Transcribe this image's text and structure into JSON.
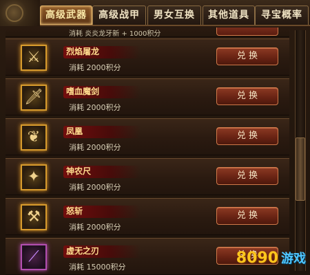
{
  "tabs": [
    {
      "label": "高级武器",
      "active": true
    },
    {
      "label": "高级战甲",
      "active": false
    },
    {
      "label": "男女互换",
      "active": false
    },
    {
      "label": "其他道具",
      "active": false
    },
    {
      "label": "寻宝概率",
      "active": false
    }
  ],
  "partial_row": {
    "cost_text": "消耗 炎炎龙牙新 + 1000积分"
  },
  "items": [
    {
      "name": "烈焰屠龙",
      "cost": "消耗 2000积分",
      "button": "兑 换",
      "icon": "sword-icon",
      "rarity": "gold"
    },
    {
      "name": "嗜血魔剑",
      "cost": "消耗 2000积分",
      "button": "兑 换",
      "icon": "sword-icon",
      "rarity": "gold"
    },
    {
      "name": "凤凰",
      "cost": "消耗 2000积分",
      "button": "兑 换",
      "icon": "bird-icon",
      "rarity": "gold"
    },
    {
      "name": "神农尺",
      "cost": "消耗 2000积分",
      "button": "兑 换",
      "icon": "ruler-icon",
      "rarity": "gold"
    },
    {
      "name": "怒斩",
      "cost": "消耗 2000积分",
      "button": "兑 换",
      "icon": "axe-icon",
      "rarity": "gold"
    },
    {
      "name": "虚无之刃",
      "cost": "消耗 15000积分",
      "button": "兑 换",
      "icon": "blade-icon",
      "rarity": "purple"
    }
  ],
  "watermark": {
    "logo": "8090",
    "text": "游戏"
  },
  "colors": {
    "gold_frame": "#d79b2d",
    "purple_frame": "#b24fb0",
    "button_red": "#8c3a23",
    "name_text": "#ffdd8e"
  }
}
